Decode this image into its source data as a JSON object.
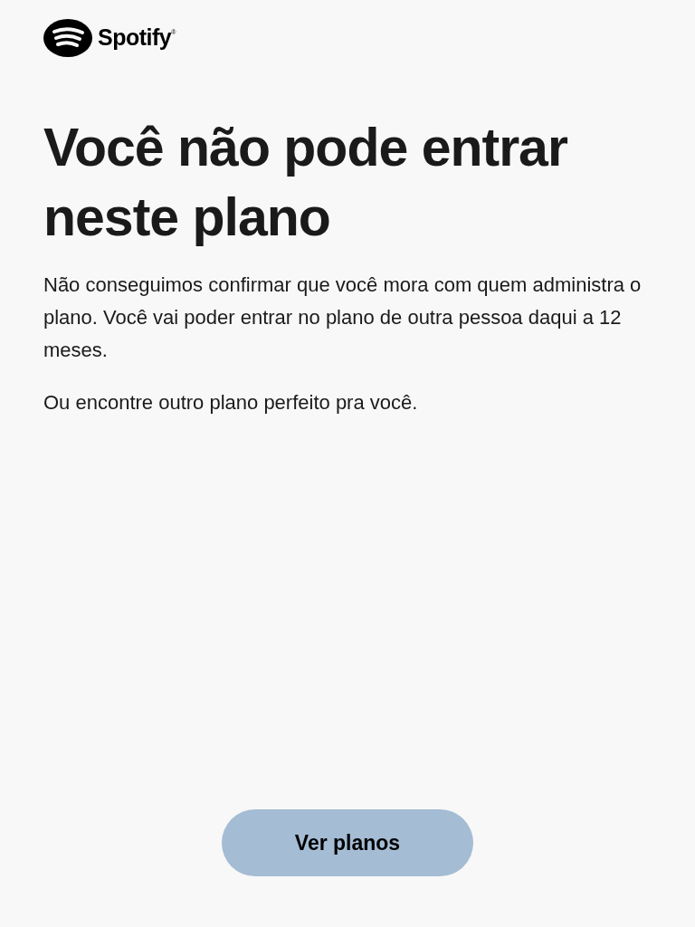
{
  "logo": {
    "text": "Spotify",
    "mark": "®"
  },
  "title": "Você não pode entrar neste plano",
  "paragraphs": [
    "Não conseguimos confirmar que você mora com quem administra o plano. Você vai poder entrar no plano de outra pessoa daqui a 12 meses.",
    "Ou encontre outro plano perfeito pra você."
  ],
  "button": "Ver planos"
}
